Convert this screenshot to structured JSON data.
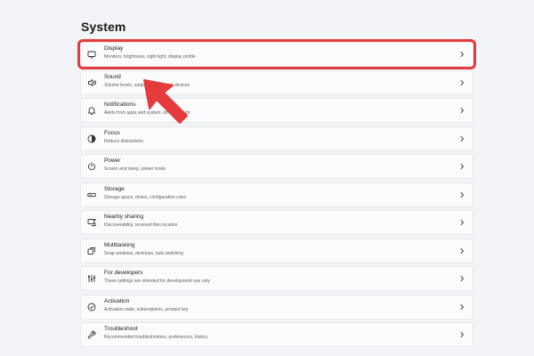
{
  "page": {
    "title": "System"
  },
  "colors": {
    "highlight": "#e53b3b",
    "arrow": "#e53b3b",
    "background": "#f3f4f8",
    "row_background": "#fbfbfd"
  },
  "settings": [
    {
      "id": "display",
      "label": "Display",
      "description": "Monitors, brightness, night light, display profile",
      "icon": "monitor-icon",
      "highlighted": true
    },
    {
      "id": "sound",
      "label": "Sound",
      "description": "Volume levels, output, input, sound devices",
      "icon": "speaker-icon",
      "highlighted": false
    },
    {
      "id": "notifications",
      "label": "Notifications",
      "description": "Alerts from apps and system, do not disturb",
      "icon": "bell-icon",
      "highlighted": false
    },
    {
      "id": "focus",
      "label": "Focus",
      "description": "Reduce distractions",
      "icon": "focus-icon",
      "highlighted": false
    },
    {
      "id": "power",
      "label": "Power",
      "description": "Screen and sleep, power mode",
      "icon": "power-icon",
      "highlighted": false
    },
    {
      "id": "storage",
      "label": "Storage",
      "description": "Storage space, drives, configuration rules",
      "icon": "storage-icon",
      "highlighted": false
    },
    {
      "id": "nearby-sharing",
      "label": "Nearby sharing",
      "description": "Discoverability, received files location",
      "icon": "share-icon",
      "highlighted": false
    },
    {
      "id": "multitasking",
      "label": "Multitasking",
      "description": "Snap windows, desktops, task switching",
      "icon": "multitasking-icon",
      "highlighted": false
    },
    {
      "id": "for-developers",
      "label": "For developers",
      "description": "These settings are intended for development use only",
      "icon": "developer-tools-icon",
      "highlighted": false
    },
    {
      "id": "activation",
      "label": "Activation",
      "description": "Activation state, subscriptions, product key",
      "icon": "check-circle-icon",
      "highlighted": false
    },
    {
      "id": "troubleshoot",
      "label": "Troubleshoot",
      "description": "Recommended troubleshooters, preferences, history",
      "icon": "wrench-icon",
      "highlighted": false
    }
  ],
  "annotation": {
    "icon": "red-arrow-icon"
  }
}
